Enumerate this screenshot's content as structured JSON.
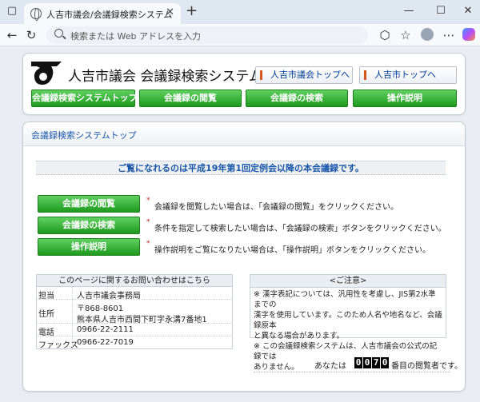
{
  "browser": {
    "tab_title": "人吉市議会/会議録検索システム",
    "address_placeholder": "検索または Web アドレスを入力"
  },
  "header": {
    "site_title": "人吉市議会 会議録検索システム",
    "top_links": [
      "人吉市議会トップへ",
      "人吉市トップへ"
    ],
    "nav": [
      "会議録検索システムトップ",
      "会議録の閲覧",
      "会議録の検索",
      "操作説明"
    ]
  },
  "main": {
    "section_title": "会議録検索システムトップ",
    "notice": "ご覧になれるのは平成19年第1回定例会以降の本会議録です。",
    "actions": [
      {
        "button": "会議録の閲覧",
        "description": "会議録を閲覧したい場合は、「会議録の閲覧」をクリックください。"
      },
      {
        "button": "会議録の検索",
        "description": "条件を指定して検索したい場合は、「会議録の検索」ボタンをクリックください。"
      },
      {
        "button": "操作説明",
        "description": "操作説明をご覧になりたい場合は、「操作説明」ボタンをクリックください。"
      }
    ],
    "contact": {
      "heading": "このページに関するお問い合わせはこちら",
      "rows": [
        {
          "label": "担当",
          "value": "人吉市議会事務局"
        },
        {
          "label": "住所",
          "value": "〒868-8601",
          "value2": "熊本県人吉市西間下町字永溝7番地1"
        },
        {
          "label": "電話",
          "value": "0966-22-2111"
        },
        {
          "label": "ファックス",
          "value": "0966-22-7019"
        }
      ]
    },
    "caution": {
      "heading": "<ご注意>",
      "lines": [
        "※ 漢字表記については、汎用性を考慮し、JIS第2水準までの",
        "漢字を使用しています。このため人名や地名など、会議録原本",
        "と異なる場合があります。",
        "※ この会議録検索システムは、人吉市議会の公式の記録では",
        "ありません。"
      ]
    },
    "counter": {
      "prefix": "あなたは",
      "digits": [
        "0",
        "0",
        "7",
        "0"
      ],
      "suffix": "番目の閲覧者です。"
    }
  }
}
